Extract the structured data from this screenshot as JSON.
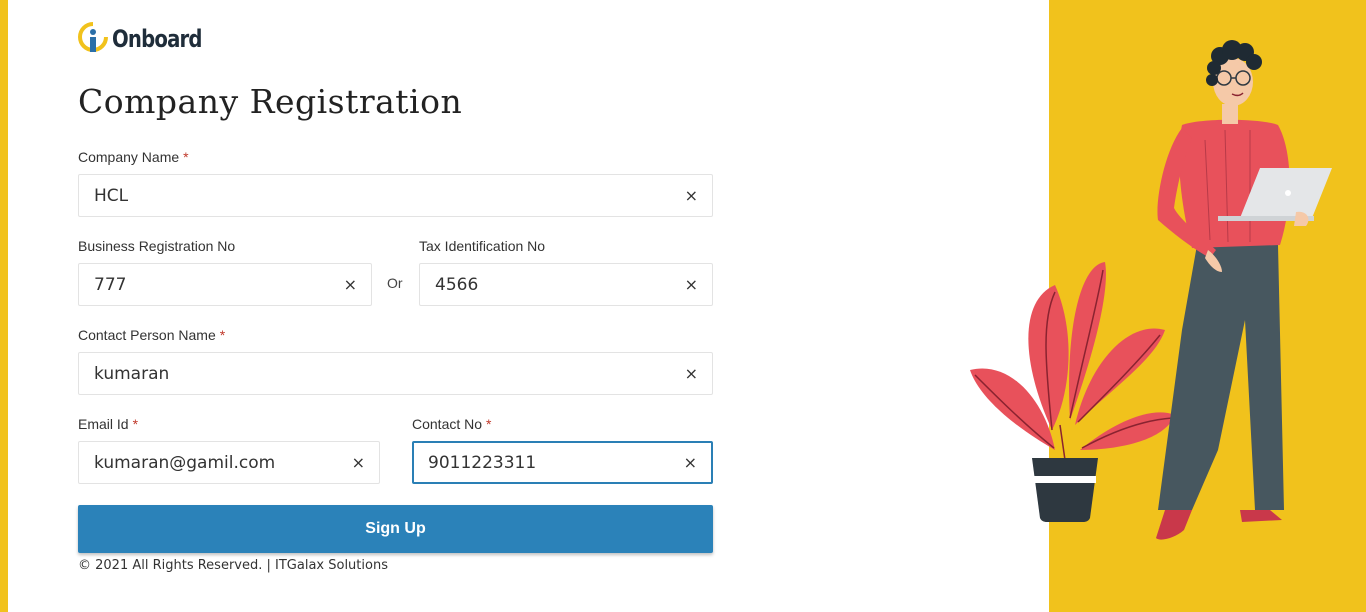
{
  "brand": {
    "name": "Onboard"
  },
  "page": {
    "title": "Company Registration"
  },
  "form": {
    "company_name": {
      "label": "Company Name",
      "required_mark": "*",
      "value": "HCL"
    },
    "business_registration_no": {
      "label": "Business Registration No",
      "value": "777"
    },
    "or_text": "Or",
    "tax_identification_no": {
      "label": "Tax Identification No",
      "value": "4566"
    },
    "contact_person_name": {
      "label": "Contact Person Name",
      "required_mark": "*",
      "value": "kumaran"
    },
    "email_id": {
      "label": "Email Id",
      "required_mark": "*",
      "value": "kumaran@gamil.com"
    },
    "contact_no": {
      "label": "Contact No",
      "required_mark": "*",
      "value": "9011223311"
    },
    "clear_icon": "×",
    "submit_label": "Sign Up"
  },
  "footer": {
    "text": "© 2021 All Rights Reserved. | ITGalax Solutions"
  },
  "colors": {
    "accent": "#f1c21c",
    "primary": "#2b82b9",
    "required": "#c0392b"
  }
}
